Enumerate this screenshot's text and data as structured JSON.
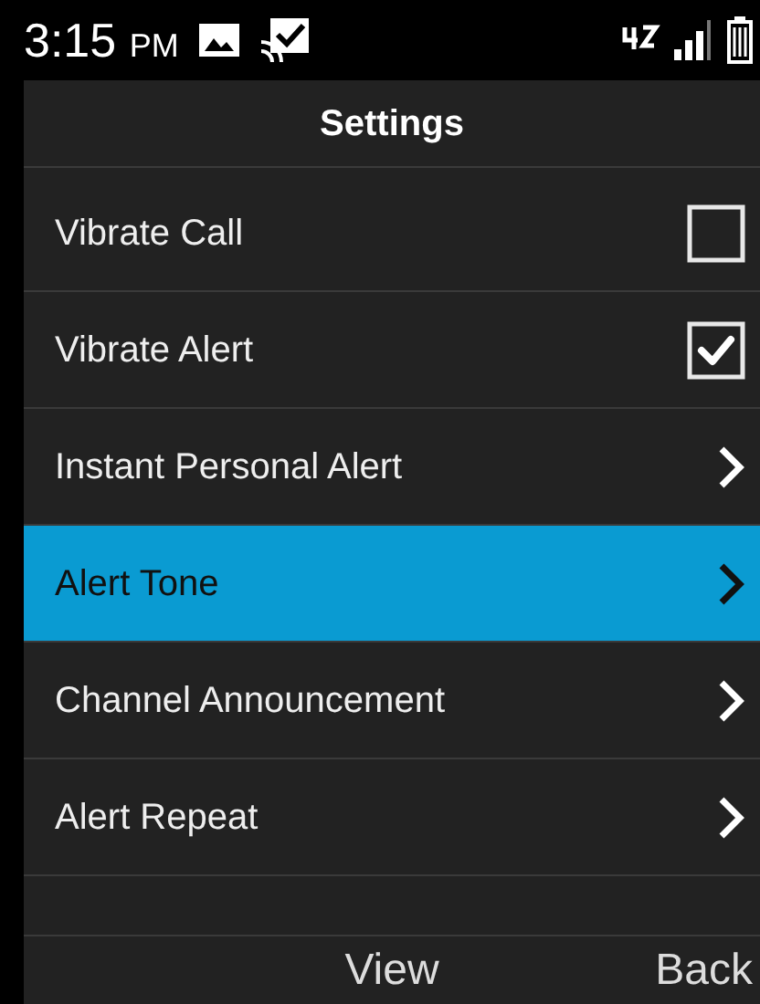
{
  "status_bar": {
    "time": "3:15",
    "ampm": "PM"
  },
  "title": "Settings",
  "items": [
    {
      "label": "Vibrate Call",
      "kind": "checkbox",
      "checked": false,
      "selected": false
    },
    {
      "label": "Vibrate Alert",
      "kind": "checkbox",
      "checked": true,
      "selected": false
    },
    {
      "label": "Instant Personal Alert",
      "kind": "link",
      "selected": false
    },
    {
      "label": "Alert Tone",
      "kind": "link",
      "selected": true
    },
    {
      "label": "Channel Announcement",
      "kind": "link",
      "selected": false
    },
    {
      "label": "Alert Repeat",
      "kind": "link",
      "selected": false
    }
  ],
  "softkeys": [
    "View",
    "Back"
  ]
}
